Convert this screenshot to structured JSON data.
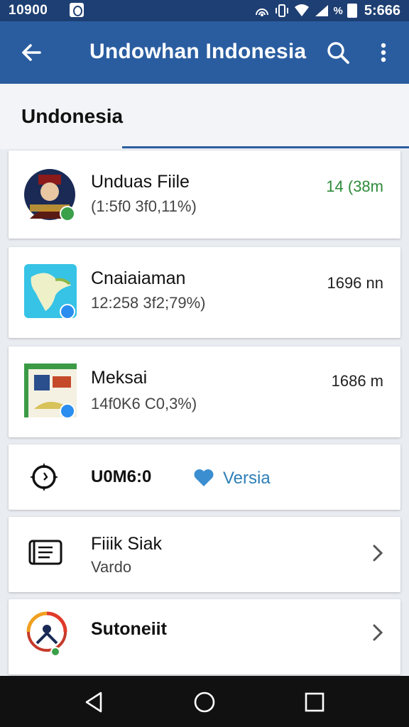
{
  "status_bar": {
    "time_left": "10900",
    "battery_pct": "%",
    "clock": "5:666"
  },
  "app_bar": {
    "title": "Undowhan Indonesia"
  },
  "section": {
    "title": "Undonesia"
  },
  "items": [
    {
      "name": "Unduas Fiile",
      "sub": "(1:5f0 3f0,11%)",
      "meta": "14 (38m"
    },
    {
      "name": "Cnaiaiaman",
      "sub": "12:258 3f2;79%)",
      "meta": "1696 nn"
    },
    {
      "name": "Meksai",
      "sub": "14f0K6 C0,3%)",
      "meta": "1686 m"
    }
  ],
  "version_row": {
    "label": "U0M6:0",
    "link": "Versia"
  },
  "rows": [
    {
      "title": "Fiiik Siak",
      "sub": "Vardo"
    },
    {
      "title": "Sutoneiit",
      "sub": ""
    }
  ],
  "colors": {
    "status_bar": "#1e3f73",
    "app_bar": "#2a5da0",
    "accent_green": "#2e8b3a",
    "heart": "#3b8ed0",
    "link": "#2d7fb8"
  }
}
